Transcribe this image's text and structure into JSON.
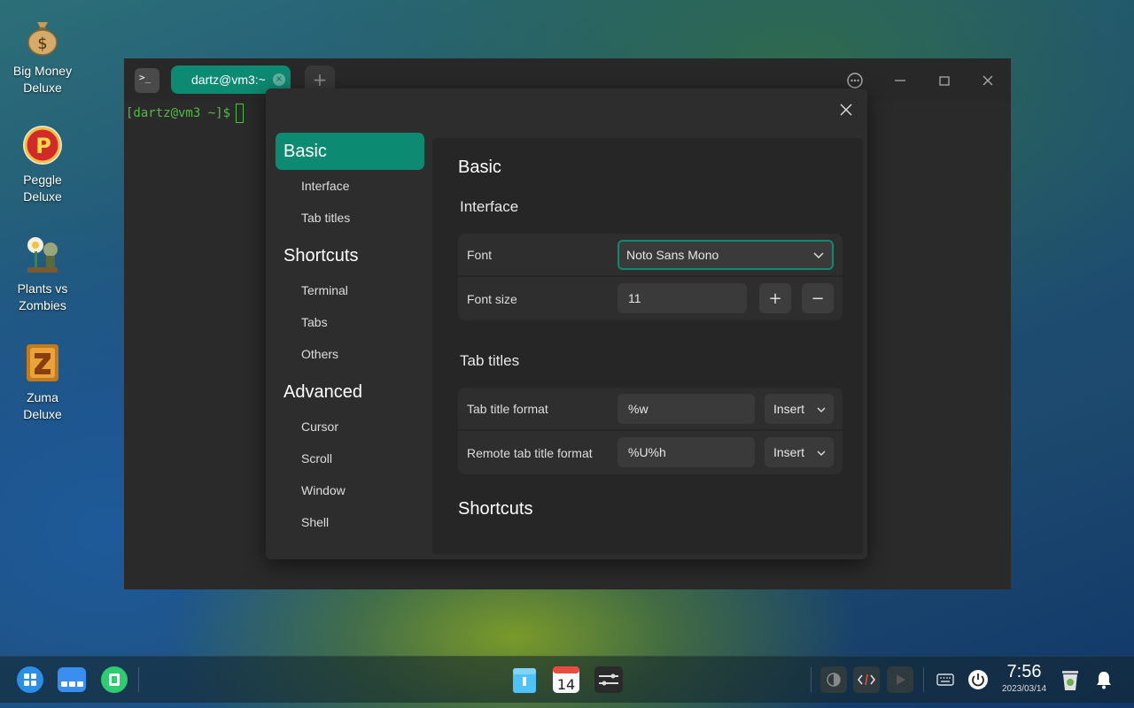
{
  "desktop": {
    "icons": [
      {
        "label": "Big Money Deluxe",
        "icon": "money-bag-icon"
      },
      {
        "label": "Peggle Deluxe",
        "icon": "peggle-icon"
      },
      {
        "label": "Plants vs Zombies",
        "icon": "plants-vs-zombies-icon"
      },
      {
        "label": "Zuma Deluxe",
        "icon": "zuma-icon"
      }
    ]
  },
  "terminal": {
    "tab_title": "dartz@vm3:~",
    "tab_close": "×",
    "add_tab": "+",
    "app_icon_text": ">_",
    "prompt": "[dartz@vm3 ~]$"
  },
  "settings": {
    "nav": [
      {
        "label": "Basic",
        "type": "head",
        "active": true
      },
      {
        "label": "Interface",
        "type": "item"
      },
      {
        "label": "Tab titles",
        "type": "item"
      },
      {
        "label": "Shortcuts",
        "type": "head"
      },
      {
        "label": "Terminal",
        "type": "item"
      },
      {
        "label": "Tabs",
        "type": "item"
      },
      {
        "label": "Others",
        "type": "item"
      },
      {
        "label": "Advanced",
        "type": "head"
      },
      {
        "label": "Cursor",
        "type": "item"
      },
      {
        "label": "Scroll",
        "type": "item"
      },
      {
        "label": "Window",
        "type": "item"
      },
      {
        "label": "Shell",
        "type": "item"
      }
    ],
    "content": {
      "section_title": "Basic",
      "interface_title": "Interface",
      "font_label": "Font",
      "font_value": "Noto Sans Mono",
      "font_size_label": "Font size",
      "font_size_value": "11",
      "increase": "+",
      "decrease": "−",
      "tab_titles_title": "Tab titles",
      "tab_title_format_label": "Tab title format",
      "tab_title_format_value": "%w",
      "remote_tab_title_format_label": "Remote tab title format",
      "remote_tab_title_format_value": "%U%h",
      "insert_label": "Insert",
      "shortcuts_title": "Shortcuts"
    }
  },
  "taskbar": {
    "calendar_day": "14",
    "time": "7:56",
    "date": "2023/03/14"
  },
  "colors": {
    "accent": "#0d8a72",
    "prompt_green": "#54b948"
  }
}
